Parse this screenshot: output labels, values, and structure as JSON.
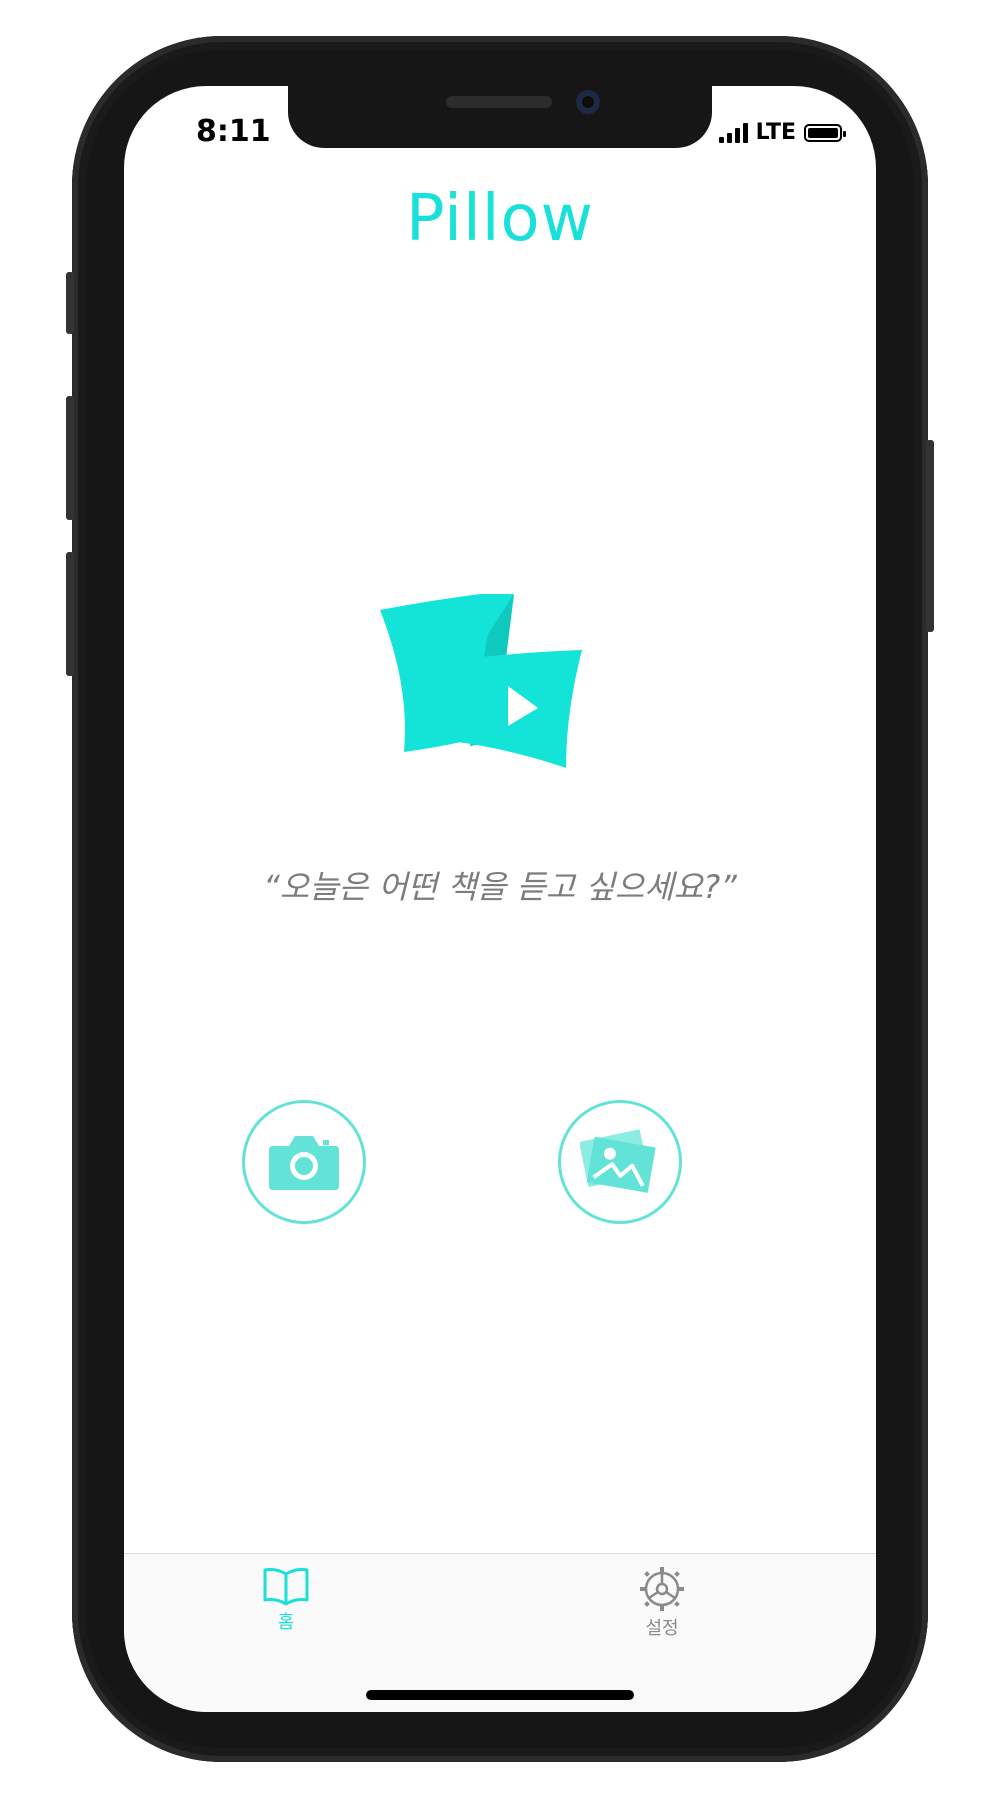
{
  "status_bar": {
    "time": "8:11",
    "network": "LTE"
  },
  "app": {
    "title": "Pillow",
    "prompt": "“오늘은 어떤 책을 듣고 싶으세요?”",
    "accent_color": "#19e0d9",
    "logo_icon": "pillow-play-logo"
  },
  "actions": {
    "camera_icon": "camera-icon",
    "gallery_icon": "photo-gallery-icon"
  },
  "tab_bar": {
    "items": [
      {
        "label": "홈",
        "icon": "open-book-icon",
        "active": true,
        "color": "#19e0d9"
      },
      {
        "label": "설정",
        "icon": "gear-icon",
        "active": false,
        "color": "#8a8a8a"
      }
    ]
  }
}
